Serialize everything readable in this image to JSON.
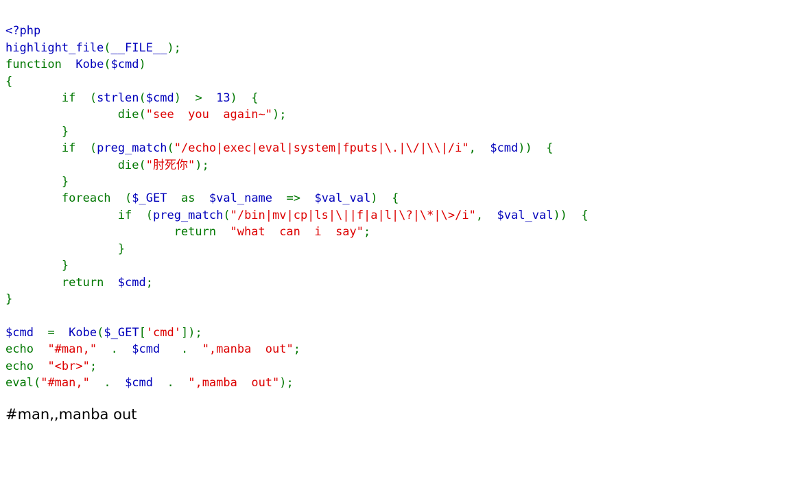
{
  "page": {
    "title": "php-highlight-file-output",
    "background_color": "#ffffff"
  },
  "colors": {
    "default": "#0000BB",
    "keyword": "#007700",
    "string": "#DD0000",
    "comment": "#FF8000",
    "html": "#000000"
  },
  "source": {
    "language": "php",
    "lines": [
      {
        "n": 1,
        "text": "<?php"
      },
      {
        "n": 2,
        "text": "highlight_file(__FILE__);"
      },
      {
        "n": 3,
        "text": "function  Kobe($cmd)"
      },
      {
        "n": 4,
        "text": "{"
      },
      {
        "n": 5,
        "text": "        if  (strlen($cmd)  >  13)  {"
      },
      {
        "n": 6,
        "text": "                die(\"see  you  again~\");"
      },
      {
        "n": 7,
        "text": "        }"
      },
      {
        "n": 8,
        "text": "        if  (preg_match(\"/echo|exec|eval|system|fputs|\\.|\\/|\\\\|/i\",  $cmd))  {"
      },
      {
        "n": 9,
        "text": "                die(\"肘死你\");"
      },
      {
        "n": 10,
        "text": "        }"
      },
      {
        "n": 11,
        "text": "        foreach  ($_GET  as  $val_name  =>  $val_val)  {"
      },
      {
        "n": 12,
        "text": "                if  (preg_match(\"/bin|mv|cp|ls|\\||f|a|l|\\?|\\*|\\>/i\",  $val_val))  {"
      },
      {
        "n": 13,
        "text": "                        return  \"what  can  i  say\";"
      },
      {
        "n": 14,
        "text": "                }"
      },
      {
        "n": 15,
        "text": "        }"
      },
      {
        "n": 16,
        "text": "        return  $cmd;"
      },
      {
        "n": 17,
        "text": "}"
      },
      {
        "n": 18,
        "text": ""
      },
      {
        "n": 19,
        "text": "$cmd  =  Kobe($_GET['cmd']);"
      },
      {
        "n": 20,
        "text": "echo  \"#man,\"  .  $cmd   .  \",manba  out\";"
      },
      {
        "n": 21,
        "text": "echo  \"<br>\";"
      },
      {
        "n": 22,
        "text": "eval(\"#man,\"  .  $cmd  .  \",mamba  out\");"
      }
    ]
  },
  "output": {
    "text": "#man,,manba out"
  }
}
